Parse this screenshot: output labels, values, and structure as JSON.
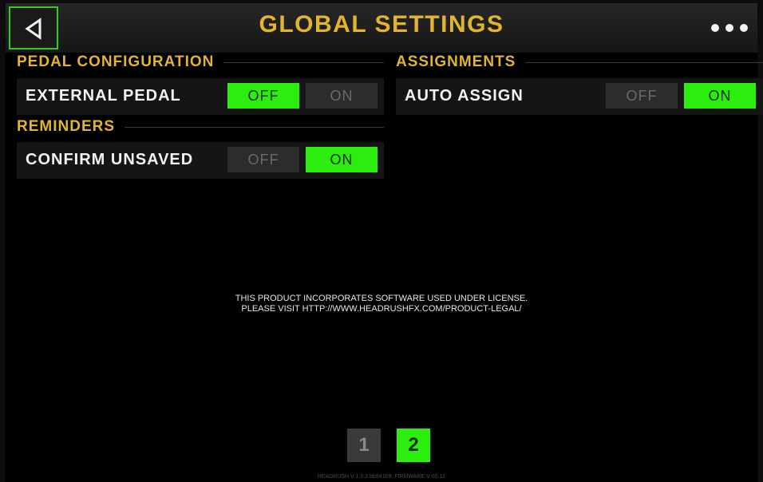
{
  "header": {
    "title": "GLOBAL SETTINGS"
  },
  "sections": {
    "pedal_configuration": {
      "title": "PEDAL CONFIGURATION",
      "external_pedal": {
        "label": "EXTERNAL PEDAL",
        "off": "OFF",
        "on": "ON",
        "selected": "OFF"
      }
    },
    "assignments": {
      "title": "ASSIGNMENTS",
      "auto_assign": {
        "label": "AUTO ASSIGN",
        "off": "OFF",
        "on": "ON",
        "selected": "ON"
      }
    },
    "reminders": {
      "title": "REMINDERS",
      "confirm_unsaved": {
        "label": "CONFIRM UNSAVED",
        "off": "OFF",
        "on": "ON",
        "selected": "ON"
      }
    }
  },
  "license": {
    "line1": "THIS PRODUCT INCORPORATES SOFTWARE USED UNDER LICENSE.",
    "line2": "PLEASE VISIT HTTP://WWW.HEADRUSHFX.COM/PRODUCT-LEGAL/"
  },
  "pagination": {
    "pages": [
      "1",
      "2"
    ],
    "current": "2"
  },
  "footer": {
    "version": "HEADRUSH V 1.0.2.bb94109. FIRMWARE V 00.12"
  },
  "colors": {
    "accent": "#e1b52c",
    "active": "#2bee0e",
    "inactive": "#2c2c2c"
  },
  "icons": {
    "back": "back-triangle-icon",
    "more": "more-dots-icon"
  }
}
